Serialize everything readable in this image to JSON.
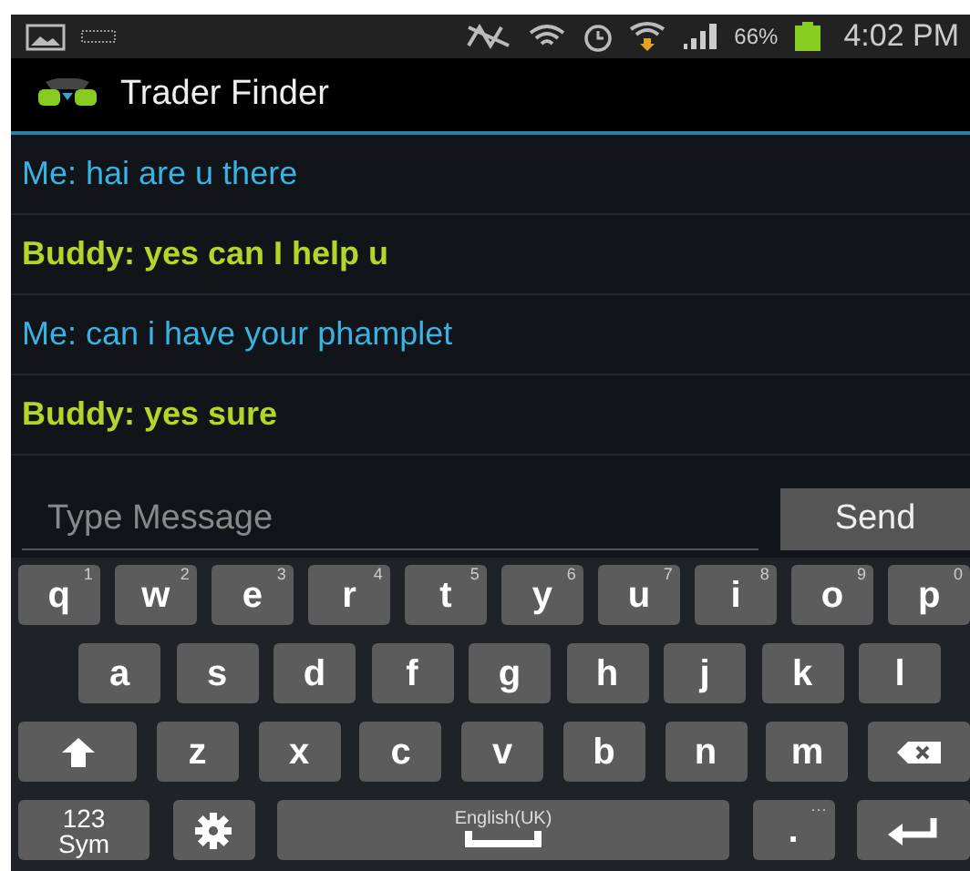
{
  "status_bar": {
    "battery": "66%",
    "time": "4:02 PM"
  },
  "app_bar": {
    "title": "Trader Finder"
  },
  "messages": [
    {
      "kind": "me",
      "text": "Me: hai are u there"
    },
    {
      "kind": "buddy",
      "text": "Buddy: yes can I help u"
    },
    {
      "kind": "me",
      "text": "Me: can i have your phamplet"
    },
    {
      "kind": "buddy",
      "text": "Buddy: yes sure"
    }
  ],
  "composer": {
    "placeholder": "Type Message",
    "button": "Send"
  },
  "keyboard": [
    [
      {
        "kind": "letter",
        "label": "q",
        "hint": "1"
      },
      {
        "kind": "letter",
        "label": "w",
        "hint": "2"
      },
      {
        "kind": "letter",
        "label": "e",
        "hint": "3"
      },
      {
        "kind": "letter",
        "label": "r",
        "hint": "4"
      },
      {
        "kind": "letter",
        "label": "t",
        "hint": "5"
      },
      {
        "kind": "letter",
        "label": "y",
        "hint": "6"
      },
      {
        "kind": "letter",
        "label": "u",
        "hint": "7"
      },
      {
        "kind": "letter",
        "label": "i",
        "hint": "8"
      },
      {
        "kind": "letter",
        "label": "o",
        "hint": "9"
      },
      {
        "kind": "letter",
        "label": "p",
        "hint": "0"
      }
    ],
    [
      {
        "kind": "letter",
        "label": "a"
      },
      {
        "kind": "letter",
        "label": "s"
      },
      {
        "kind": "letter",
        "label": "d"
      },
      {
        "kind": "letter",
        "label": "f"
      },
      {
        "kind": "letter",
        "label": "g"
      },
      {
        "kind": "letter",
        "label": "h"
      },
      {
        "kind": "letter",
        "label": "j"
      },
      {
        "kind": "letter",
        "label": "k"
      },
      {
        "kind": "letter",
        "label": "l"
      }
    ],
    [
      {
        "kind": "shift"
      },
      {
        "kind": "letter",
        "label": "z"
      },
      {
        "kind": "letter",
        "label": "x"
      },
      {
        "kind": "letter",
        "label": "c"
      },
      {
        "kind": "letter",
        "label": "v"
      },
      {
        "kind": "letter",
        "label": "b"
      },
      {
        "kind": "letter",
        "label": "n"
      },
      {
        "kind": "letter",
        "label": "m"
      },
      {
        "kind": "backspace"
      }
    ],
    [
      {
        "kind": "sym",
        "label": "123",
        "sub": "Sym"
      },
      {
        "kind": "settings"
      },
      {
        "kind": "space",
        "label": "English(UK)"
      },
      {
        "kind": "period",
        "label": ".",
        "hint": "···"
      },
      {
        "kind": "enter"
      }
    ]
  ]
}
